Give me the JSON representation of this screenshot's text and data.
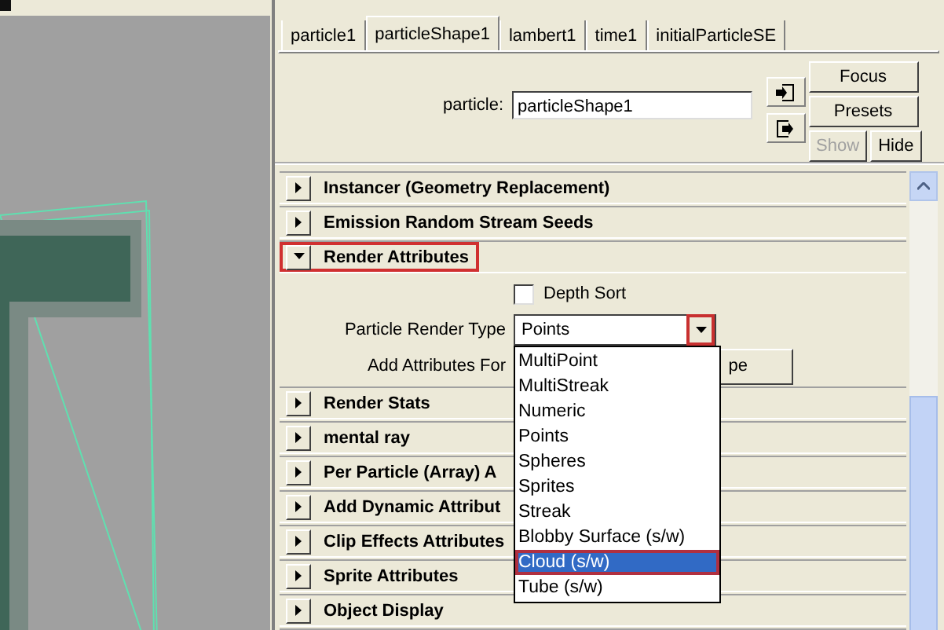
{
  "tabs": [
    {
      "label": "particle1",
      "selected": false
    },
    {
      "label": "particleShape1",
      "selected": true
    },
    {
      "label": "lambert1",
      "selected": false
    },
    {
      "label": "time1",
      "selected": false
    },
    {
      "label": "initialParticleSE",
      "selected": false
    }
  ],
  "node_field": {
    "label": "particle:",
    "value": "particleShape1"
  },
  "buttons": [
    {
      "label": "Focus",
      "disabled": false
    },
    {
      "label": "Presets",
      "disabled": false
    },
    {
      "label": "Show",
      "disabled": true
    },
    {
      "label": "Hide",
      "disabled": false
    }
  ],
  "sections": [
    {
      "title": "Instancer (Geometry Replacement)",
      "expanded": false,
      "outlined": false
    },
    {
      "title": "Emission Random Stream Seeds",
      "expanded": false,
      "outlined": false
    },
    {
      "title": "Render Attributes",
      "expanded": true,
      "outlined": true,
      "depth_sort": {
        "label": "Depth Sort",
        "checked": false
      },
      "render_type": {
        "label": "Particle Render Type",
        "value": "Points",
        "arrow_outlined": true
      },
      "add_attributes": {
        "label": "Add Attributes For",
        "button": "pe"
      }
    },
    {
      "title": "Render Stats",
      "expanded": false,
      "outlined": false
    },
    {
      "title": "mental ray",
      "expanded": false,
      "outlined": false
    },
    {
      "title": "Per Particle (Array) A",
      "expanded": false,
      "outlined": false
    },
    {
      "title": "Add Dynamic Attribut",
      "expanded": false,
      "outlined": false
    },
    {
      "title": "Clip Effects Attributes",
      "expanded": false,
      "outlined": false
    },
    {
      "title": "Sprite Attributes",
      "expanded": false,
      "outlined": false
    },
    {
      "title": "Object Display",
      "expanded": false,
      "outlined": false
    }
  ],
  "dropdown": {
    "options": [
      {
        "label": "MultiPoint",
        "selected": false,
        "outlined": false
      },
      {
        "label": "MultiStreak",
        "selected": false,
        "outlined": false
      },
      {
        "label": "Numeric",
        "selected": false,
        "outlined": false
      },
      {
        "label": "Points",
        "selected": false,
        "outlined": false
      },
      {
        "label": "Spheres",
        "selected": false,
        "outlined": false
      },
      {
        "label": "Sprites",
        "selected": false,
        "outlined": false
      },
      {
        "label": "Streak",
        "selected": false,
        "outlined": false
      },
      {
        "label": "Blobby Surface (s/w)",
        "selected": false,
        "outlined": false
      },
      {
        "label": "Cloud (s/w)",
        "selected": true,
        "outlined": true
      },
      {
        "label": "Tube (s/w)",
        "selected": false,
        "outlined": false
      }
    ]
  }
}
